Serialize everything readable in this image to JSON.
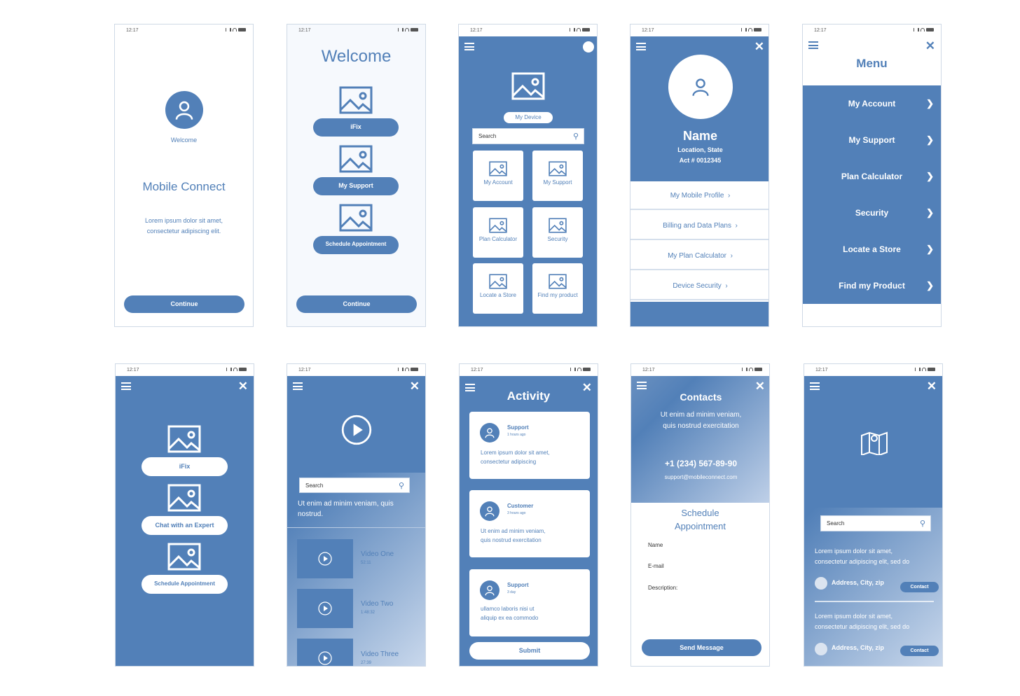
{
  "status_time": "12:17",
  "s1": {
    "welcome": "Welcome",
    "title": "Mobile Connect",
    "body1": "Lorem ipsum dolor sit amet,",
    "body2": "consectetur adipiscing elit.",
    "continue": "Continue"
  },
  "s2": {
    "title": "Welcome",
    "btn1": "iFix",
    "btn2": "My Support",
    "btn3": "Schedule Appointment",
    "continue": "Continue"
  },
  "s3": {
    "device": "My Device",
    "search": "Search",
    "tiles": [
      "My Account",
      "My Support",
      "Plan Calculator",
      "Security",
      "Locate a Store",
      "Find my product"
    ]
  },
  "s4": {
    "name": "Name",
    "location": "Location, State",
    "acct": "Act # 0012345",
    "rows": [
      "My Mobile Profile",
      "Billing and Data Plans",
      "My Plan Calculator",
      "Device Security"
    ]
  },
  "s5": {
    "title": "Menu",
    "items": [
      "My Account",
      "My Support",
      "Plan Calculator",
      "Security",
      "Locate a Store",
      "Find my Product"
    ]
  },
  "s6": {
    "btn1": "iFix",
    "btn2": "Chat with an Expert",
    "btn3": "Schedule Appointment"
  },
  "s7": {
    "search": "Search",
    "body": "Ut enim ad minim veniam, quis nostrud.",
    "videos": [
      {
        "title": "Video One",
        "time": "52:11"
      },
      {
        "title": "Video Two",
        "time": "1:48:32"
      },
      {
        "title": "Video Three",
        "time": "27:39"
      }
    ]
  },
  "s8": {
    "title": "Activity",
    "cards": [
      {
        "who": "Support",
        "when": "1 hours ago",
        "l1": "Lorem ipsum dolor sit amet,",
        "l2": "consectetur adipiscing"
      },
      {
        "who": "Customer",
        "when": "3 hours ago",
        "l1": "Ut enim ad minim veniam,",
        "l2": "quis nostrud exercitation"
      },
      {
        "who": "Support",
        "when": "3 day",
        "l1": "ullamco laboris nisi ut",
        "l2": "aliquip ex ea commodo"
      }
    ],
    "submit": "Submit"
  },
  "s9": {
    "title": "Contacts",
    "l1": "Ut enim ad minim veniam,",
    "l2": "quis nostrud exercitation",
    "phone": "+1 (234) 567-89-90",
    "email": "support@mobileconnect.com",
    "sched1": "Schedule",
    "sched2": "Appointment",
    "f_name": "Name",
    "f_email": "E-mail",
    "f_desc": "Description:",
    "send": "Send Message"
  },
  "s10": {
    "search": "Search",
    "stores": [
      {
        "l1": "Lorem ipsum dolor sit amet,",
        "l2": "consectetur adipiscing elit, sed do",
        "addr": "Address, City, zip",
        "contact": "Contact"
      },
      {
        "l1": "Lorem ipsum dolor sit amet,",
        "l2": "consectetur adipiscing elit, sed do",
        "addr": "Address, City, zip",
        "contact": "Contact"
      }
    ]
  },
  "colors": {
    "primary": "#5280b8",
    "light": "#c9d8ec",
    "white": "#ffffff"
  }
}
